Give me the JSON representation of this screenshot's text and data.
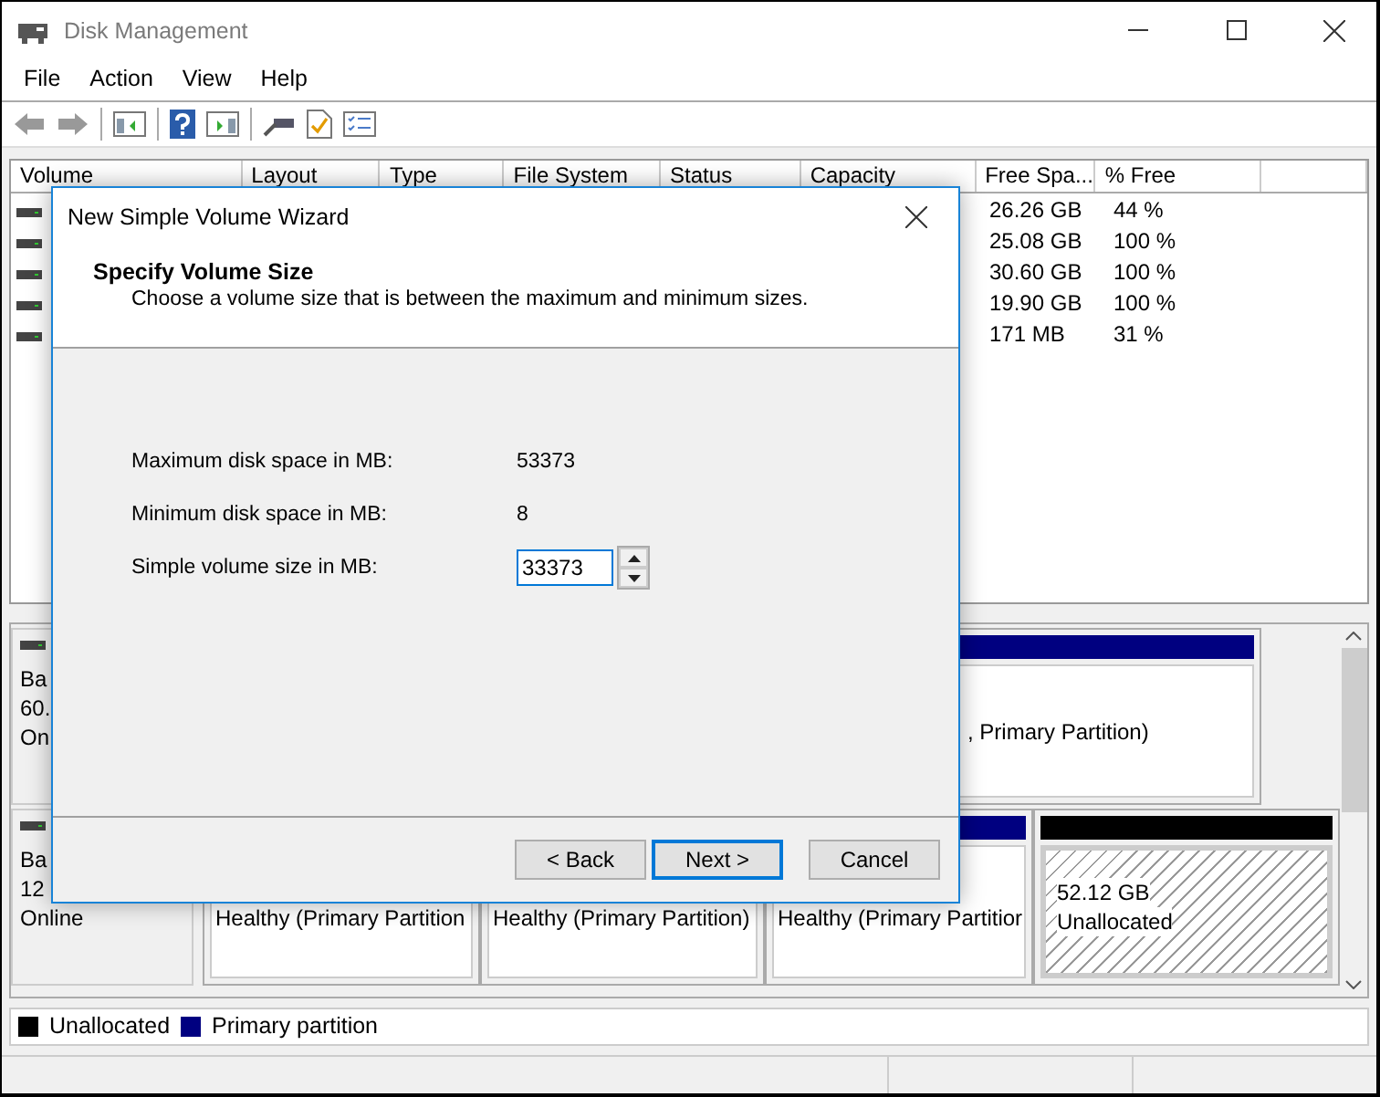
{
  "window": {
    "title": "Disk Management"
  },
  "menu": [
    "File",
    "Action",
    "View",
    "Help"
  ],
  "volume_list": {
    "columns": [
      "Volume",
      "Layout",
      "Type",
      "File System",
      "Status",
      "Capacity",
      "Free Spa...",
      "% Free"
    ],
    "rows": [
      {
        "free_space": "26.26 GB",
        "percent_free": "44 %"
      },
      {
        "free_space": "25.08 GB",
        "percent_free": "100 %"
      },
      {
        "free_space": "30.60 GB",
        "percent_free": "100 %"
      },
      {
        "free_space": "19.90 GB",
        "percent_free": "100 %"
      },
      {
        "free_space": "171 MB",
        "percent_free": "31 %"
      }
    ]
  },
  "disks": [
    {
      "label_lines": [
        "Ba",
        "60.",
        "On"
      ],
      "partitions": [
        {
          "kind": "primary",
          "lines": [
            ", Primary Partition)"
          ]
        }
      ]
    },
    {
      "label_lines": [
        "Ba",
        "12",
        "Online"
      ],
      "partitions": [
        {
          "kind": "primary",
          "lines": [
            "Healthy (Primary Partition"
          ]
        },
        {
          "kind": "primary",
          "lines": [
            "Healthy (Primary Partition)"
          ]
        },
        {
          "kind": "primary",
          "lines": [
            "Healthy (Primary Partitior"
          ]
        },
        {
          "kind": "unallocated",
          "lines": [
            "52.12 GB",
            "Unallocated"
          ]
        }
      ]
    }
  ],
  "legend": [
    {
      "label": "Unallocated",
      "color": "#000000"
    },
    {
      "label": "Primary partition",
      "color": "#000080"
    }
  ],
  "dialog": {
    "title": "New Simple Volume Wizard",
    "heading": "Specify Volume Size",
    "subtitle": "Choose a volume size that is between the maximum and minimum sizes.",
    "fields": [
      {
        "kind": "text",
        "label": "Maximum disk space in MB:",
        "value": "53373"
      },
      {
        "kind": "text",
        "label": "Minimum disk space in MB:",
        "value": "8"
      },
      {
        "kind": "spinner",
        "label": "Simple volume size in MB:",
        "value": "33373"
      }
    ],
    "buttons": [
      {
        "label": "< Back",
        "focused": false
      },
      {
        "label": "Next >",
        "focused": true
      },
      {
        "label": "Cancel",
        "focused": false
      }
    ]
  }
}
